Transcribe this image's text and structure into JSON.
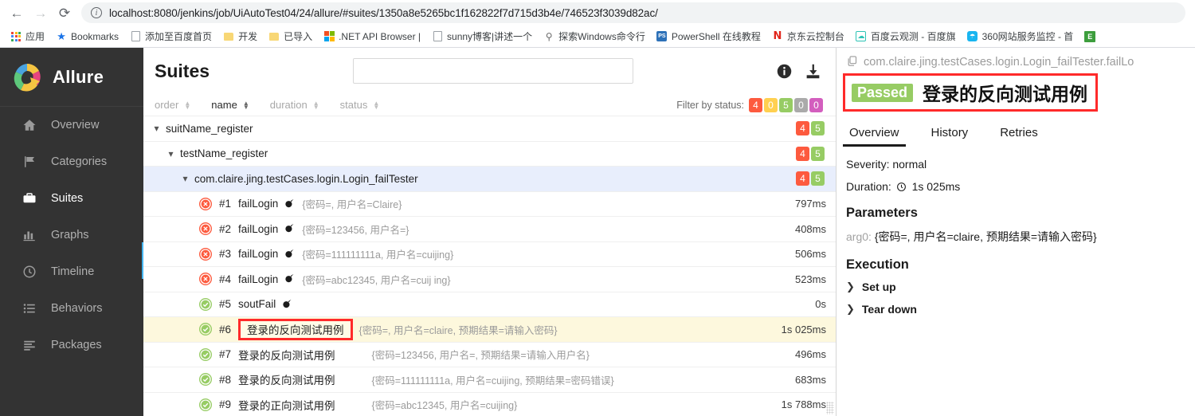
{
  "browser": {
    "back_icon": "arrow-left-icon",
    "forward_icon": "arrow-right-icon",
    "reload_icon": "reload-icon",
    "url": "localhost:8080/jenkins/job/UiAutoTest04/24/allure/#suites/1350a8e5265bc1f162822f7d715d3b4e/746523f3039d82ac/",
    "bookmarks": [
      {
        "label": "应用",
        "icon": "apps-grid-icon"
      },
      {
        "label": "Bookmarks",
        "icon": "star-icon"
      },
      {
        "label": "添加至百度首页",
        "icon": "page-icon"
      },
      {
        "label": "开发",
        "icon": "folder-icon"
      },
      {
        "label": "已导入",
        "icon": "folder-icon"
      },
      {
        "label": ".NET API Browser |",
        "icon": "microsoft-icon"
      },
      {
        "label": "sunny博客|讲述一个",
        "icon": "page-icon"
      },
      {
        "label": "探索Windows命令行",
        "icon": "windows-terminal-icon"
      },
      {
        "label": "PowerShell 在线教程",
        "icon": "powershell-icon"
      },
      {
        "label": "京东云控制台",
        "icon": "jd-icon"
      },
      {
        "label": "百度云观测 - 百度旗",
        "icon": "baidu-cloud-icon"
      },
      {
        "label": "360网站服务监控 - 首",
        "icon": "360-icon"
      },
      {
        "label": "",
        "icon": "green-app-icon"
      }
    ]
  },
  "sidebar": {
    "brand": "Allure",
    "items": [
      {
        "label": "Overview",
        "icon": "home-icon",
        "active": false
      },
      {
        "label": "Categories",
        "icon": "flag-icon",
        "active": false
      },
      {
        "label": "Suites",
        "icon": "briefcase-icon",
        "active": true
      },
      {
        "label": "Graphs",
        "icon": "bar-chart-icon",
        "active": false
      },
      {
        "label": "Timeline",
        "icon": "clock-icon",
        "active": false
      },
      {
        "label": "Behaviors",
        "icon": "list-icon",
        "active": false
      },
      {
        "label": "Packages",
        "icon": "layers-icon",
        "active": false
      }
    ]
  },
  "tree": {
    "title": "Suites",
    "search_placeholder": "",
    "search_value": "",
    "info_icon": "info-icon",
    "download_icon": "download-icon",
    "sort_columns": [
      {
        "label": "order",
        "active": false
      },
      {
        "label": "name",
        "active": true
      },
      {
        "label": "duration",
        "active": false
      },
      {
        "label": "status",
        "active": false
      }
    ],
    "filter_label": "Filter by status:",
    "filter_badges": [
      {
        "value": "4",
        "color": "#fd5a3e"
      },
      {
        "value": "0",
        "color": "#ffd050"
      },
      {
        "value": "5",
        "color": "#97cc64"
      },
      {
        "value": "0",
        "color": "#aaaaaa"
      },
      {
        "value": "0",
        "color": "#d35ebe"
      }
    ],
    "groups": [
      {
        "name": "suitName_register",
        "indent": 0,
        "badges": [
          {
            "value": "4",
            "color": "#fd5a3e"
          },
          {
            "value": "5",
            "color": "#97cc64"
          }
        ],
        "selected": false
      },
      {
        "name": "testName_register",
        "indent": 1,
        "badges": [
          {
            "value": "4",
            "color": "#fd5a3e"
          },
          {
            "value": "5",
            "color": "#97cc64"
          }
        ],
        "selected": false
      },
      {
        "name": "com.claire.jing.testCases.login.Login_failTester",
        "indent": 2,
        "badges": [
          {
            "value": "4",
            "color": "#fd5a3e"
          },
          {
            "value": "5",
            "color": "#97cc64"
          }
        ],
        "selected": true
      }
    ],
    "tests": [
      {
        "status": "failed",
        "num": "#1",
        "name": "failLogin",
        "params": "{密码=, 用户名=Claire}",
        "duration": "797ms",
        "highlight": false,
        "boxed": false
      },
      {
        "status": "failed",
        "num": "#2",
        "name": "failLogin",
        "params": "{密码=123456, 用户名=}",
        "duration": "408ms",
        "highlight": false,
        "boxed": false
      },
      {
        "status": "failed",
        "num": "#3",
        "name": "failLogin",
        "params": "{密码=111111111a, 用户名=cuijing}",
        "duration": "506ms",
        "highlight": false,
        "boxed": false
      },
      {
        "status": "failed",
        "num": "#4",
        "name": "failLogin",
        "params": "{密码=abc12345, 用户名=cuij ing}",
        "duration": "523ms",
        "highlight": false,
        "boxed": false
      },
      {
        "status": "passed",
        "num": "#5",
        "name": "soutFail",
        "params": "",
        "duration": "0s",
        "highlight": false,
        "boxed": false
      },
      {
        "status": "passed",
        "num": "#6",
        "name": "登录的反向测试用例",
        "params": "{密码=, 用户名=claire, 预期结果=请输入密码}",
        "duration": "1s 025ms",
        "highlight": true,
        "boxed": true
      },
      {
        "status": "passed",
        "num": "#7",
        "name": "登录的反向测试用例",
        "params": "{密码=123456, 用户名=, 预期结果=请输入用户名}",
        "duration": "496ms",
        "highlight": false,
        "boxed": false
      },
      {
        "status": "passed",
        "num": "#8",
        "name": "登录的反向测试用例",
        "params": "{密码=111111111a, 用户名=cuijing, 预期结果=密码错误}",
        "duration": "683ms",
        "highlight": false,
        "boxed": false
      },
      {
        "status": "passed",
        "num": "#9",
        "name": "登录的正向测试用例",
        "params": "{密码=abc12345, 用户名=cuijing}",
        "duration": "1s 788ms",
        "highlight": false,
        "boxed": false
      }
    ]
  },
  "detail": {
    "breadcrumb": "com.claire.jing.testCases.login.Login_failTester.failLo",
    "copy_icon": "copy-icon",
    "status_badge": "Passed",
    "status_color": "#97cc64",
    "title": "登录的反向测试用例",
    "tabs": [
      {
        "label": "Overview",
        "active": true
      },
      {
        "label": "History",
        "active": false
      },
      {
        "label": "Retries",
        "active": false
      }
    ],
    "severity": "Severity: normal",
    "duration_label": "Duration:",
    "duration_value": "1s 025ms",
    "parameters_heading": "Parameters",
    "parameters": [
      {
        "key": "arg0:",
        "value": "{密码=, 用户名=claire, 预期结果=请输入密码}"
      }
    ],
    "execution_heading": "Execution",
    "execution_items": [
      {
        "label": "Set up",
        "chevron": "chevron-right-icon"
      },
      {
        "label": "Tear down",
        "chevron": "chevron-right-icon"
      }
    ]
  }
}
